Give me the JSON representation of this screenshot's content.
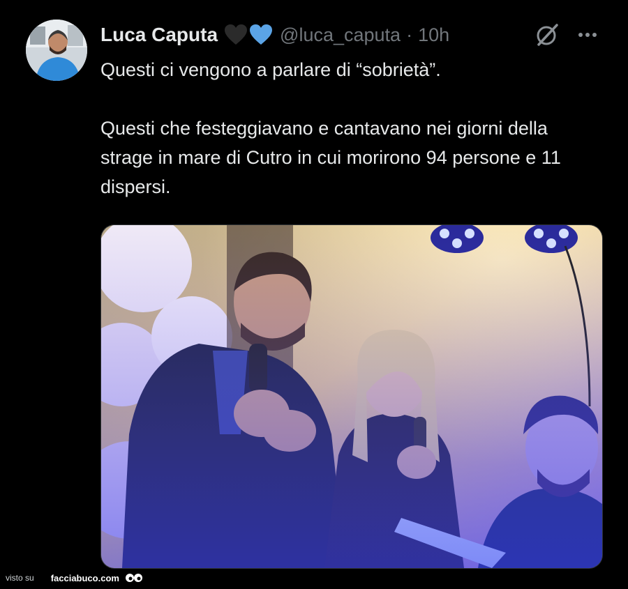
{
  "author": {
    "display_name": "Luca Caputa",
    "handle": "@luca_caputa",
    "separator": "·",
    "time": "10h",
    "badges": [
      "black-heart-icon",
      "blue-heart-icon"
    ]
  },
  "actions": {
    "grok_icon": "grok-icon",
    "more_label": "···"
  },
  "tweet": {
    "lines": [
      "Questi ci vengono a parlare di “sobrietà”.",
      "Questi che festeggiavano e cantavano nei giorni della strage in mare di Cutro in cui morirono 94 persone e 11 dispersi."
    ]
  },
  "media": {
    "type": "photo"
  },
  "watermark": {
    "prefix": "visto su",
    "brand": "facciabuco.com"
  },
  "colors": {
    "background": "#000000",
    "text": "#e7e9ea",
    "muted": "#71767b",
    "blue_heart": "#5ba4e6",
    "black_heart": "#2b2b2b"
  }
}
